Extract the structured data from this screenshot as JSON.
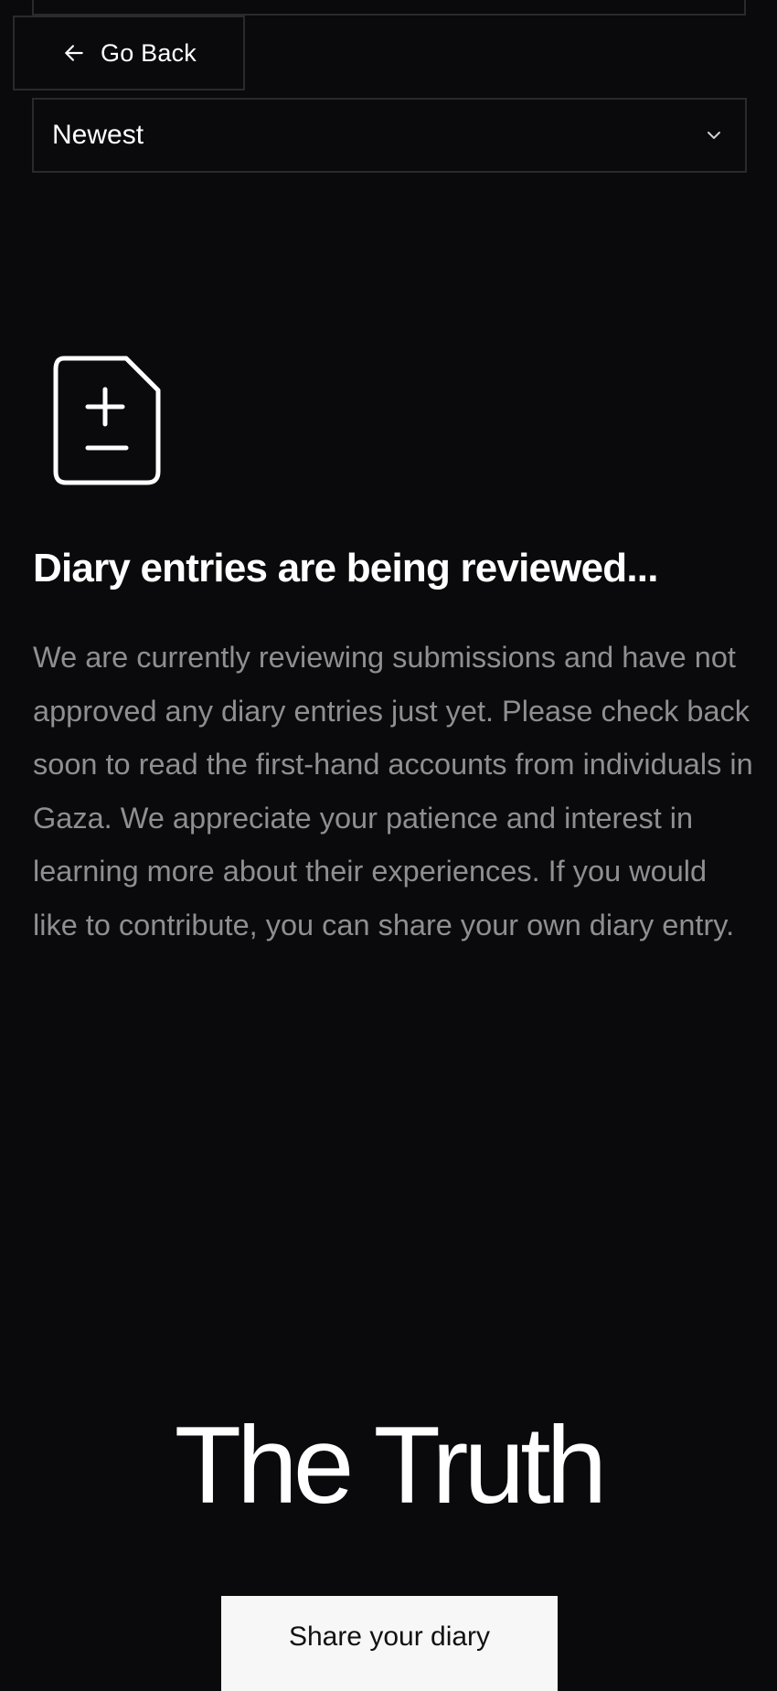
{
  "nav": {
    "back_label": "Go Back",
    "back_icon": "arrow-left-icon"
  },
  "filter": {
    "sort_value": "Newest",
    "dropdown_icon": "chevron-down-icon"
  },
  "empty_state": {
    "icon": "document-plus-minus-icon",
    "heading": "Diary entries are being reviewed...",
    "message": "We are currently reviewing submissions and have not approved any diary entries just yet. Please check back soon to read the first-hand accounts from individuals in Gaza. We appreciate your patience and interest in learning more about their experiences. If you would like to contribute, you can share your own diary entry."
  },
  "footer": {
    "title": "The Truth",
    "cta_label": "Share your diary"
  },
  "colors": {
    "background": "#0a0a0c",
    "text_primary": "#ffffff",
    "text_secondary": "#8e8e93",
    "border": "#2a2a2e",
    "button_bg": "#f7f7f7",
    "button_text": "#111111"
  }
}
